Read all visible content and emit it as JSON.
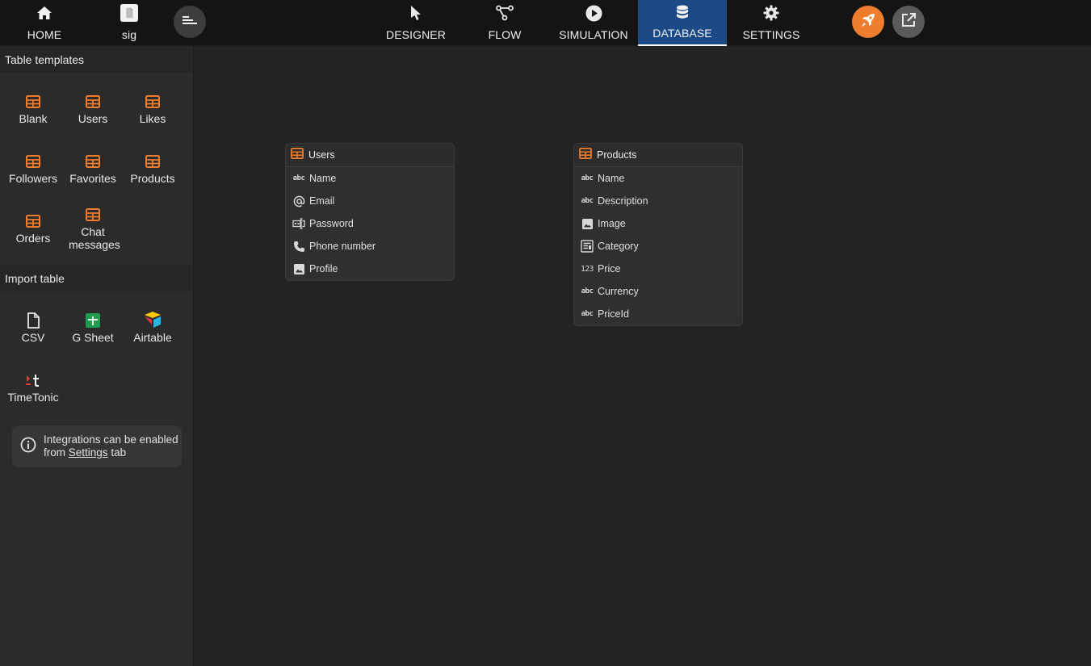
{
  "colors": {
    "accent": "#ee7d2e",
    "active_tab": "#1b4a86",
    "topbar": "#141414",
    "sidebar": "#2b2b2b",
    "canvas": "#232323"
  },
  "topbar": {
    "home_label": "HOME",
    "project_label": "sig",
    "tabs": [
      {
        "label": "DESIGNER",
        "icon": "cursor-icon"
      },
      {
        "label": "FLOW",
        "icon": "flow-icon"
      },
      {
        "label": "SIMULATION",
        "icon": "play-icon"
      },
      {
        "label": "DATABASE",
        "icon": "database-icon",
        "active": true
      },
      {
        "label": "SETTINGS",
        "icon": "gear-icon"
      }
    ]
  },
  "sidebar": {
    "templates_title": "Table templates",
    "templates": [
      "Blank",
      "Users",
      "Likes",
      "Followers",
      "Favorites",
      "Products",
      "Orders",
      "Chat messages"
    ],
    "import_title": "Import table",
    "imports": [
      "CSV",
      "G Sheet",
      "Airtable",
      "TimeTonic"
    ],
    "info": {
      "text_before": "Integrations can be enabled from",
      "link": "Settings",
      "text_after": "tab"
    }
  },
  "tables": [
    {
      "name": "Users",
      "fields": [
        {
          "name": "Name",
          "icon": "text-type-icon"
        },
        {
          "name": "Email",
          "icon": "at-icon"
        },
        {
          "name": "Password",
          "icon": "password-icon"
        },
        {
          "name": "Phone number",
          "icon": "phone-icon"
        },
        {
          "name": "Profile",
          "icon": "image-icon"
        }
      ]
    },
    {
      "name": "Products",
      "fields": [
        {
          "name": "Name",
          "icon": "text-type-icon"
        },
        {
          "name": "Description",
          "icon": "text-type-icon"
        },
        {
          "name": "Image",
          "icon": "image-icon"
        },
        {
          "name": "Category",
          "icon": "category-icon"
        },
        {
          "name": "Price",
          "icon": "number-type-icon"
        },
        {
          "name": "Currency",
          "icon": "text-type-icon"
        },
        {
          "name": "PriceId",
          "icon": "text-type-icon"
        }
      ]
    }
  ]
}
